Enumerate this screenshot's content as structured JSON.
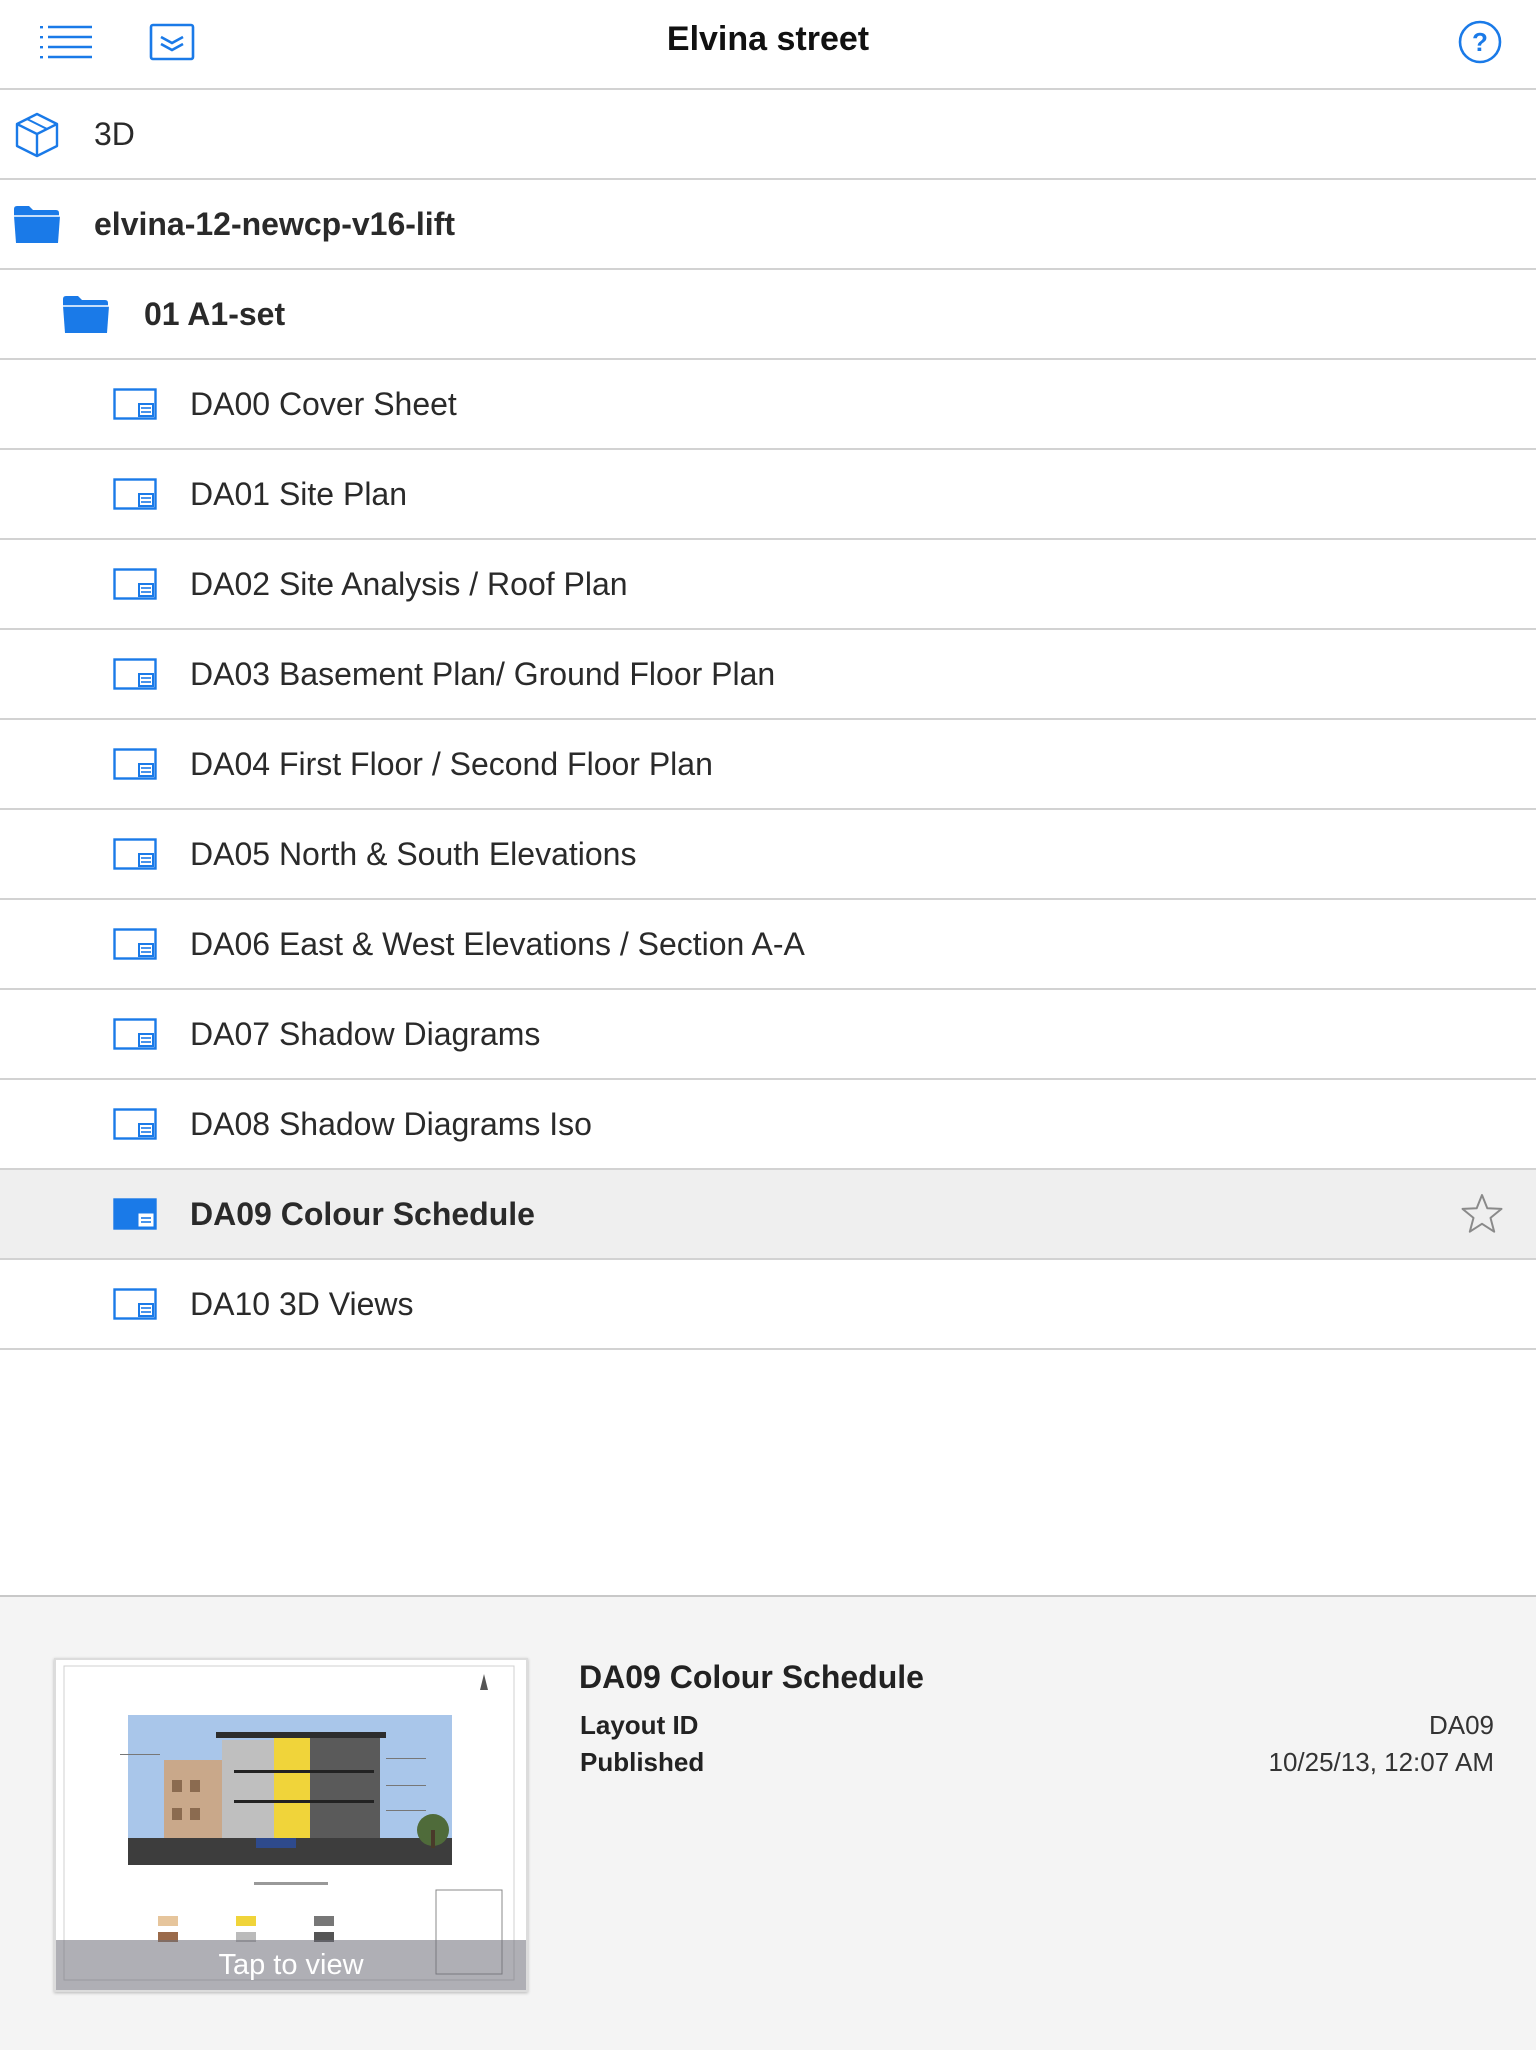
{
  "header": {
    "title": "Elvina street"
  },
  "list": {
    "root_item": {
      "label": "3D"
    },
    "folder_model": {
      "label": "elvina-12-newcp-v16-lift"
    },
    "folder_set": {
      "label": "01 A1-set"
    },
    "layouts": [
      {
        "label": "DA00 Cover Sheet"
      },
      {
        "label": "DA01 Site Plan"
      },
      {
        "label": "DA02 Site Analysis / Roof Plan"
      },
      {
        "label": "DA03 Basement Plan/ Ground Floor Plan"
      },
      {
        "label": "DA04 First Floor / Second Floor Plan"
      },
      {
        "label": "DA05 North & South Elevations"
      },
      {
        "label": "DA06 East & West Elevations / Section A-A"
      },
      {
        "label": "DA07 Shadow Diagrams"
      },
      {
        "label": "DA08 Shadow Diagrams  Iso"
      },
      {
        "label": "DA09 Colour Schedule",
        "selected": true
      },
      {
        "label": "DA10 3D Views"
      }
    ]
  },
  "detail": {
    "title": "DA09 Colour Schedule",
    "layout_id_label": "Layout ID",
    "layout_id_value": "DA09",
    "published_label": "Published",
    "published_value": "10/25/13, 12:07 AM",
    "thumbnail_action": "Tap to view"
  },
  "colors": {
    "accent": "#1a7ae8",
    "separator": "#d2d2d2",
    "selected_row": "#efefef",
    "panel_bg": "#f4f4f4"
  },
  "icons": {
    "menu": "list-menu-icon",
    "layers": "layers-icon",
    "help": "help-circle-icon",
    "model": "3d-cube-icon",
    "folder": "folder-icon",
    "layout": "layout-sheet-icon",
    "favorite": "star-outline-icon"
  }
}
